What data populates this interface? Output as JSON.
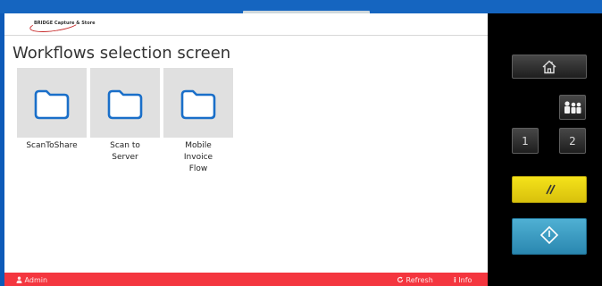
{
  "app": {
    "logo_text": "BRIDGE Capture & Store"
  },
  "page": {
    "title": "Workflows selection screen"
  },
  "workflows": [
    {
      "label": "ScanToShare",
      "icon": "folder-icon"
    },
    {
      "label": "Scan to Server",
      "icon": "folder-icon"
    },
    {
      "label": "Mobile Invoice Flow",
      "icon": "folder-icon"
    }
  ],
  "footer": {
    "user_label": "Admin",
    "user_icon": "user-icon",
    "refresh_label": "Refresh",
    "refresh_icon": "refresh-icon",
    "info_label": "Info",
    "info_icon": "info-icon"
  },
  "keypad": {
    "home_icon": "home-icon",
    "user_icon": "users-icon",
    "key1_label": "1",
    "key2_label": "2",
    "reset_icon": "reset-icon",
    "start_icon": "start-icon"
  },
  "colors": {
    "footer_bg": "#f4363f",
    "folder_stroke": "#1a6fc9",
    "reset_key": "#f5e21a",
    "start_key": "#3a9fc6",
    "frame_bg": "#0d5ab8"
  }
}
